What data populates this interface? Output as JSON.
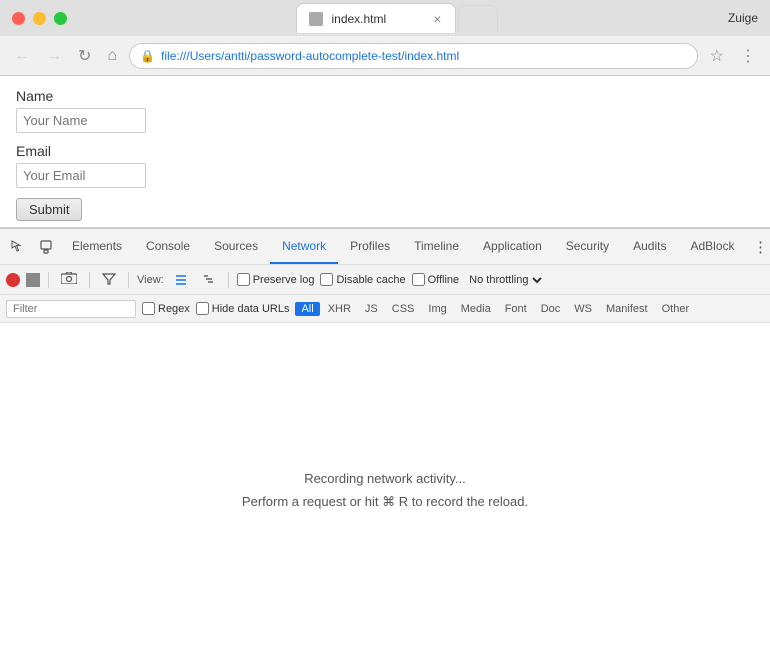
{
  "window": {
    "username": "Zuige",
    "tab": {
      "title": "index.html",
      "favicon": "📄"
    },
    "url": "file:///Users/antti/password-autocomplete-test/index.html"
  },
  "nav": {
    "back": "←",
    "forward": "→",
    "reload": "↻",
    "home": "⌂"
  },
  "toolbar": {
    "bookmark": "☆",
    "menu": "⋮"
  },
  "form": {
    "name_label": "Name",
    "name_placeholder": "Your Name",
    "email_label": "Email",
    "email_placeholder": "Your Email",
    "submit_label": "Submit"
  },
  "devtools": {
    "tabs": [
      {
        "id": "elements",
        "label": "Elements",
        "active": false
      },
      {
        "id": "console",
        "label": "Console",
        "active": false
      },
      {
        "id": "sources",
        "label": "Sources",
        "active": false
      },
      {
        "id": "network",
        "label": "Network",
        "active": true
      },
      {
        "id": "profiles",
        "label": "Profiles",
        "active": false
      },
      {
        "id": "timeline",
        "label": "Timeline",
        "active": false
      },
      {
        "id": "application",
        "label": "Application",
        "active": false
      },
      {
        "id": "security",
        "label": "Security",
        "active": false
      },
      {
        "id": "audits",
        "label": "Audits",
        "active": false
      },
      {
        "id": "adblock",
        "label": "AdBlock",
        "active": false
      }
    ],
    "network": {
      "view_label": "View:",
      "preserve_log_label": "Preserve log",
      "disable_cache_label": "Disable cache",
      "offline_label": "Offline",
      "throttle_label": "No throttling",
      "filter_placeholder": "Filter",
      "regex_label": "Regex",
      "hide_data_urls_label": "Hide data URLs",
      "filter_types": [
        "All",
        "XHR",
        "JS",
        "CSS",
        "Img",
        "Media",
        "Font",
        "Doc",
        "WS",
        "Manifest",
        "Other"
      ],
      "active_filter": "All",
      "recording_text": "Recording network activity...",
      "recording_hint": "Perform a request or hit ⌘ R to record the reload."
    }
  }
}
